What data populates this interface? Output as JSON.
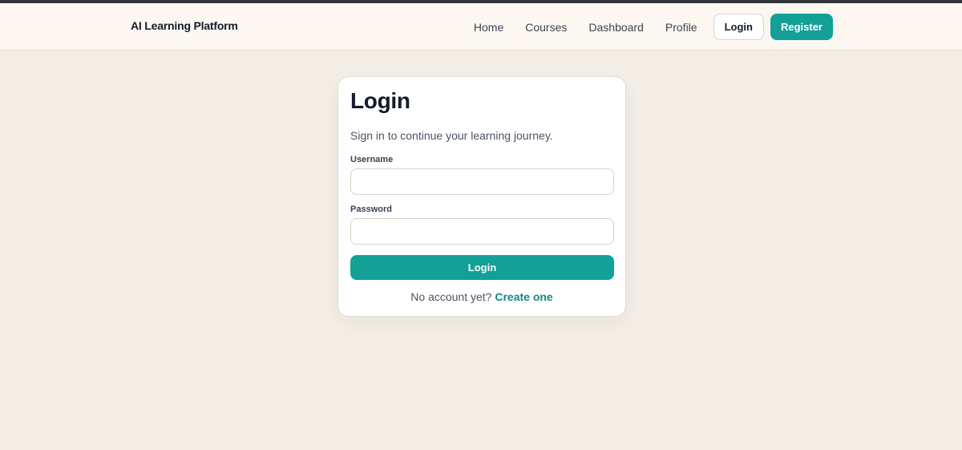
{
  "app": {
    "brand": "AI Learning Platform"
  },
  "nav": {
    "links": [
      "Home",
      "Courses",
      "Dashboard",
      "Profile"
    ],
    "login_label": "Login",
    "register_label": "Register"
  },
  "login_form": {
    "title": "Login",
    "subtitle": "Sign in to continue your learning journey.",
    "username_label": "Username",
    "username_value": "",
    "password_label": "Password",
    "password_value": "",
    "submit_label": "Login",
    "footer_text": "No account yet?",
    "create_link": "Create one"
  },
  "colors": {
    "accent": "#12a097",
    "background": "#f3eee6",
    "navbar": "#fcf8f1",
    "top_strip": "#33343a"
  }
}
